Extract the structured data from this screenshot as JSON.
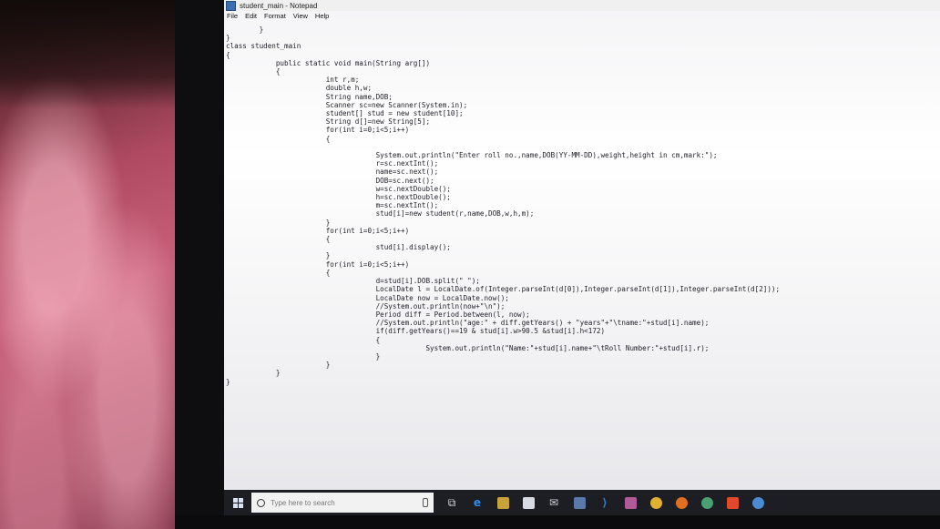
{
  "window": {
    "title": "student_main - Notepad"
  },
  "menu": {
    "items": [
      "File",
      "Edit",
      "Format",
      "View",
      "Help"
    ]
  },
  "editor": {
    "code": "        }\n}\nclass student_main\n{\n            public static void main(String arg[])\n            {\n                        int r,m;\n                        double h,w;\n                        String name,DOB;\n                        Scanner sc=new Scanner(System.in);\n                        student[] stud = new student[10];\n                        String d[]=new String[5];\n                        for(int i=0;i<5;i++)\n                        {\n\n                                    System.out.println(\"Enter roll no.,name,DOB(YY-MM-DD),weight,height in cm,mark:\");\n                                    r=sc.nextInt();\n                                    name=sc.next();\n                                    DOB=sc.next();\n                                    w=sc.nextDouble();\n                                    h=sc.nextDouble();\n                                    m=sc.nextInt();\n                                    stud[i]=new student(r,name,DOB,w,h,m);\n                        }\n                        for(int i=0;i<5;i++)\n                        {\n                                    stud[i].display();\n                        }\n                        for(int i=0;i<5;i++)\n                        {\n                                    d=stud[i].DOB.split(\" \");\n                                    LocalDate l = LocalDate.of(Integer.parseInt(d[0]),Integer.parseInt(d[1]),Integer.parseInt(d[2]));\n                                    LocalDate now = LocalDate.now();\n                                    //System.out.println(now+\"\\n\");\n                                    Period diff = Period.between(l, now);\n                                    //System.out.println(\"age:\" + diff.getYears() + \"years\"+\"\\tname:\"+stud[i].name);\n                                    if(diff.getYears()==19 & stud[i].w>90.5 &stud[i].h<172)\n                                    {\n                                                System.out.println(\"Name:\"+stud[i].name+\"\\tRoll Number:\"+stud[i].r);\n                                    }\n                        }\n            }\n}"
  },
  "taskbar": {
    "search_placeholder": "Type here to search",
    "icons": [
      "task-view-icon",
      "edge-icon",
      "file-explorer-icon",
      "store-icon",
      "mail-icon",
      "app-icon",
      "vscode-icon",
      "app-icon",
      "chrome-icon",
      "firefox-icon",
      "app-icon",
      "app-icon",
      "app-icon"
    ],
    "colors": {
      "edge": "#2f8ee8",
      "vscode": "#2a7fd0",
      "chrome": "#e0b030",
      "firefox": "#e07020"
    }
  }
}
